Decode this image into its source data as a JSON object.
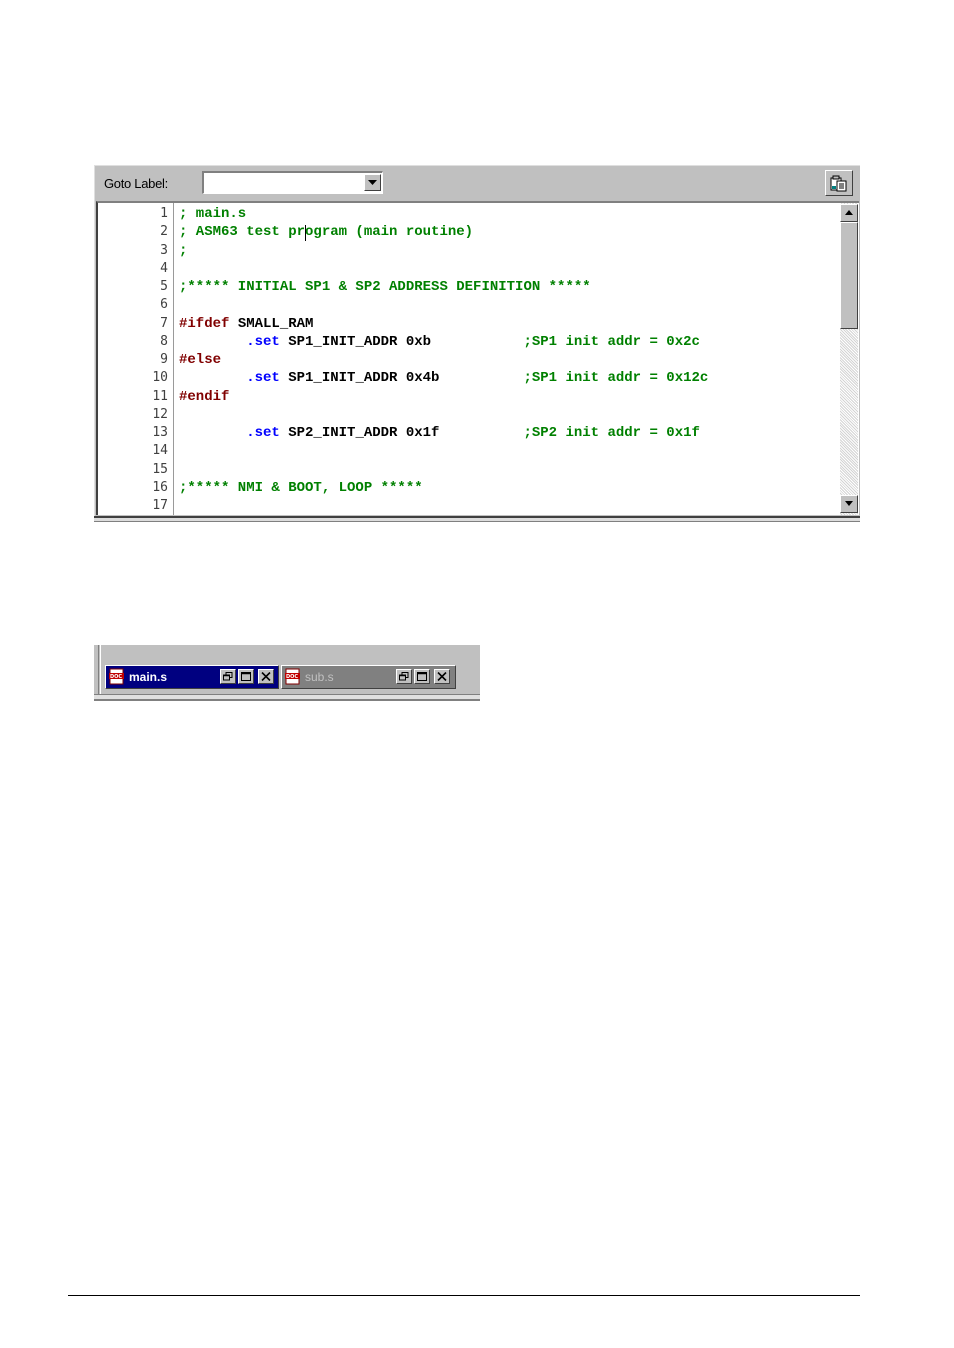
{
  "editor": {
    "goto_label": "Goto Label:",
    "goto_value": "",
    "icons": {
      "combo_arrow": "chevron-down-icon",
      "toolbar_button": "paste-document-icon",
      "scroll_up": "arrow-up-icon",
      "scroll_down": "arrow-down-icon"
    },
    "lines": [
      {
        "n": "1",
        "segments": [
          {
            "t": "; main.s",
            "c": "comment"
          }
        ]
      },
      {
        "n": "2",
        "segments": [
          {
            "t": "; ASM63 test program (main routine)",
            "c": "comment"
          }
        ]
      },
      {
        "n": "3",
        "segments": [
          {
            "t": ";",
            "c": "comment"
          }
        ]
      },
      {
        "n": "4",
        "segments": []
      },
      {
        "n": "5",
        "segments": [
          {
            "t": ";***** INITIAL SP1 & SP2 ADDRESS DEFINITION *****",
            "c": "comment"
          }
        ]
      },
      {
        "n": "6",
        "segments": []
      },
      {
        "n": "7",
        "segments": [
          {
            "t": "#ifdef",
            "c": "directive"
          },
          {
            "t": " SMALL_RAM",
            "c": "plain"
          }
        ]
      },
      {
        "n": "8",
        "segments": [
          {
            "t": "        ",
            "c": "plain"
          },
          {
            "t": ".set",
            "c": "keyword"
          },
          {
            "t": " SP1_INIT_ADDR 0xb           ",
            "c": "plain"
          },
          {
            "t": ";SP1 init addr = 0x2c",
            "c": "comment"
          }
        ]
      },
      {
        "n": "9",
        "segments": [
          {
            "t": "#else",
            "c": "directive"
          }
        ]
      },
      {
        "n": "10",
        "segments": [
          {
            "t": "        ",
            "c": "plain"
          },
          {
            "t": ".set",
            "c": "keyword"
          },
          {
            "t": " SP1_INIT_ADDR 0x4b          ",
            "c": "plain"
          },
          {
            "t": ";SP1 init addr = 0x12c",
            "c": "comment"
          }
        ]
      },
      {
        "n": "11",
        "segments": [
          {
            "t": "#endif",
            "c": "directive"
          }
        ]
      },
      {
        "n": "12",
        "segments": []
      },
      {
        "n": "13",
        "segments": [
          {
            "t": "        ",
            "c": "plain"
          },
          {
            "t": ".set",
            "c": "keyword"
          },
          {
            "t": " SP2_INIT_ADDR 0x1f          ",
            "c": "plain"
          },
          {
            "t": ";SP2 init addr = 0x1f",
            "c": "comment"
          }
        ]
      },
      {
        "n": "14",
        "segments": []
      },
      {
        "n": "15",
        "segments": []
      },
      {
        "n": "16",
        "segments": [
          {
            "t": ";***** NMI & BOOT, LOOP *****",
            "c": "comment"
          }
        ]
      },
      {
        "n": "17",
        "segments": []
      }
    ]
  },
  "mdi": {
    "tabs": [
      {
        "title": "main.s",
        "active": true,
        "icon": "doc-file-icon"
      },
      {
        "title": "sub.s",
        "active": false,
        "icon": "doc-file-icon"
      }
    ],
    "window_buttons": [
      "restore-icon",
      "maximize-icon",
      "close-icon"
    ]
  },
  "colors": {
    "comment": "#008000",
    "directive": "#800000",
    "keyword": "#0000ff",
    "plain": "#000000",
    "active_title": "#000080",
    "inactive_title": "#808080"
  }
}
